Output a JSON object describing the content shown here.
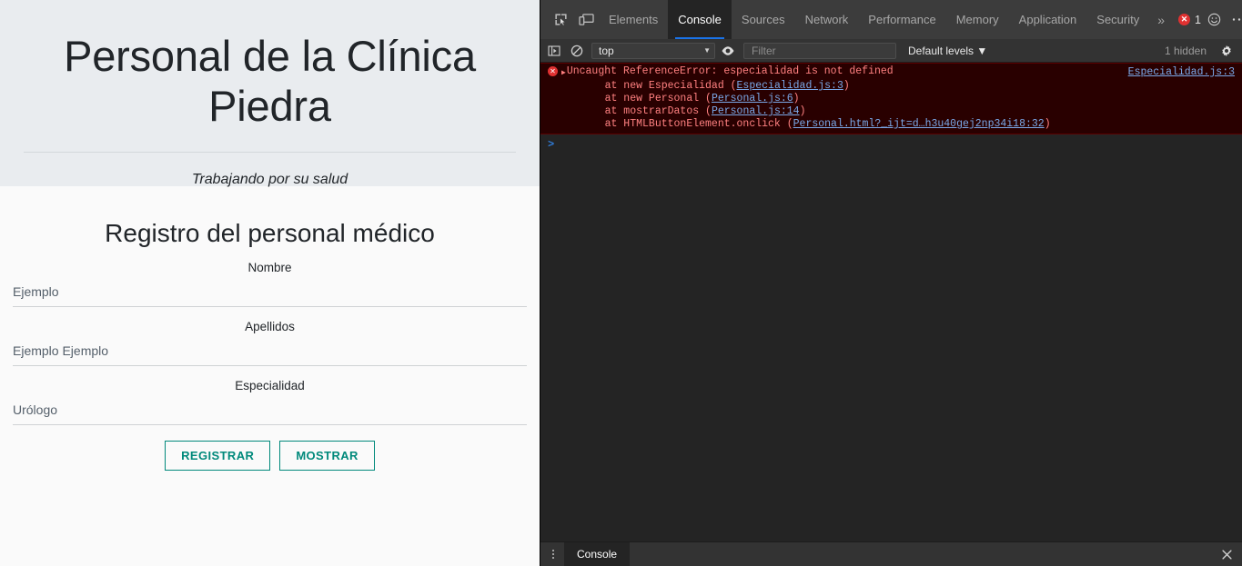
{
  "page": {
    "hero": {
      "title": "Personal de la Clínica Piedra",
      "subtitle": "Trabajando por su salud"
    },
    "form": {
      "title": "Registro del personal médico",
      "fields": [
        {
          "label": "Nombre",
          "value": "Ejemplo",
          "name": "nombre"
        },
        {
          "label": "Apellidos",
          "value": "Ejemplo Ejemplo",
          "name": "apellidos"
        },
        {
          "label": "Especialidad",
          "value": "Urólogo",
          "name": "especialidad"
        }
      ],
      "buttons": {
        "register": "REGISTRAR",
        "show": "MOSTRAR"
      }
    },
    "colors": {
      "accent": "#00897b",
      "hero_bg": "#e9ecef",
      "body_bg": "#fafafa"
    }
  },
  "devtools": {
    "tabs": [
      {
        "label": "Elements",
        "active": false
      },
      {
        "label": "Console",
        "active": true
      },
      {
        "label": "Sources",
        "active": false
      },
      {
        "label": "Network",
        "active": false
      },
      {
        "label": "Performance",
        "active": false
      },
      {
        "label": "Memory",
        "active": false
      },
      {
        "label": "Application",
        "active": false
      },
      {
        "label": "Security",
        "active": false
      }
    ],
    "more_tabs_glyph": "»",
    "error_badge": {
      "icon": "✕",
      "count": "1"
    },
    "feedback_icon": "☺",
    "menu_icon": "⋯",
    "close_icon": "✕",
    "toolbar": {
      "context": "top",
      "context_caret": "▼",
      "filter_placeholder": "Filter",
      "levels": "Default levels ▼",
      "hidden": "1 hidden"
    },
    "console": {
      "error": {
        "message": "Uncaught ReferenceError: especialidad is not defined",
        "source_link": "Especialidad.js:3",
        "stack": [
          {
            "prefix": "    at new Especialidad (",
            "link": "Especialidad.js:3",
            "suffix": ")"
          },
          {
            "prefix": "    at new Personal (",
            "link": "Personal.js:6",
            "suffix": ")"
          },
          {
            "prefix": "    at mostrarDatos (",
            "link": "Personal.js:14",
            "suffix": ")"
          },
          {
            "prefix": "    at HTMLButtonElement.onclick (",
            "link": "Personal.html?_ijt=d…h3u40gej2np34i18:32",
            "suffix": ")"
          }
        ]
      },
      "prompt": ">"
    },
    "drawer": {
      "tab": "Console",
      "close_icon": "✕"
    },
    "colors": {
      "tabbar_bg": "#3c3c3c",
      "panel_bg": "#242424",
      "error_bg": "#290000",
      "error_text": "#ff8080",
      "link": "#7aa8e8",
      "active_underline": "#1a73e8"
    }
  }
}
